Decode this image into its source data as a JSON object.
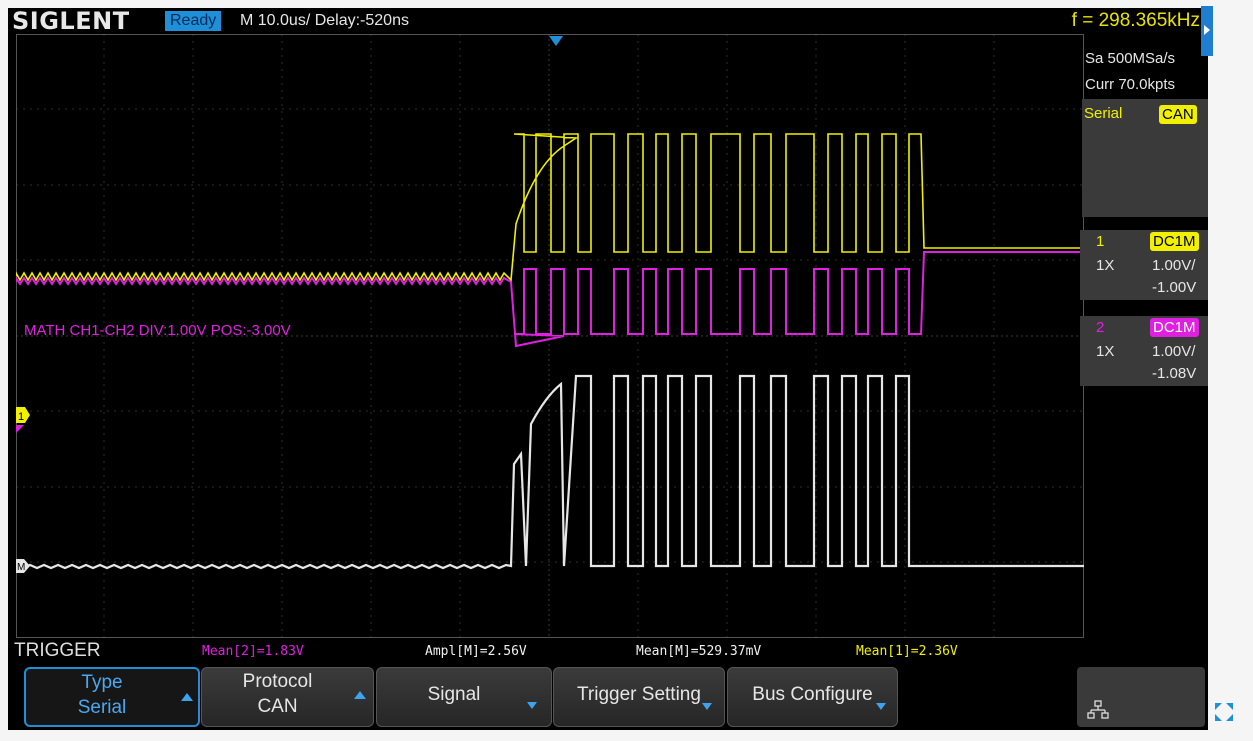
{
  "header": {
    "brand": "SIGLENT",
    "status": "Ready",
    "timebase": "M 10.0us/  Delay:-520ns",
    "frequency": "f = 298.365kHz"
  },
  "side_panel": {
    "sample_rate": "Sa 500MSa/s",
    "memory_depth": "Curr 70.0kpts",
    "serial_label": "Serial",
    "serial_protocol": "CAN",
    "channel1": {
      "number": "1",
      "coupling": "DC1M",
      "probe": "1X",
      "scale": "1.00V/",
      "offset": "-1.00V",
      "color": "#f0f000"
    },
    "channel2": {
      "number": "2",
      "coupling": "DC1M",
      "probe": "1X",
      "scale": "1.00V/",
      "offset": "-1.08V",
      "color": "#e020e0"
    }
  },
  "math_label": "MATH  CH1-CH2  DIV:1.00V  POS:-3.00V",
  "markers": {
    "ch1": "1",
    "math": "M"
  },
  "menu": {
    "title": "TRIGGER",
    "softkeys": [
      {
        "line1": "Type",
        "line2": "Serial"
      },
      {
        "line1": "Protocol",
        "line2": "CAN"
      },
      {
        "line1": "Signal",
        "line2": ""
      },
      {
        "line1": "Trigger Setting",
        "line2": ""
      },
      {
        "line1": "Bus Configure",
        "line2": ""
      }
    ]
  },
  "measurements": [
    {
      "text": "Mean[2]=1.83V",
      "color": "#e020e0"
    },
    {
      "text": "Ampl[M]=2.56V",
      "color": "#f0f0f0"
    },
    {
      "text": "Mean[M]=529.37mV",
      "color": "#f0f0f0"
    },
    {
      "text": "Mean[1]=2.36V",
      "color": "#f0f000"
    }
  ],
  "icons": [
    "network-icon",
    "fullscreen-icon",
    "trigger-position-icon"
  ],
  "colors": {
    "accent": "#1f8fd8",
    "ch1": "#f0f000",
    "ch2": "#e020e0",
    "math": "#e6e6e6"
  }
}
